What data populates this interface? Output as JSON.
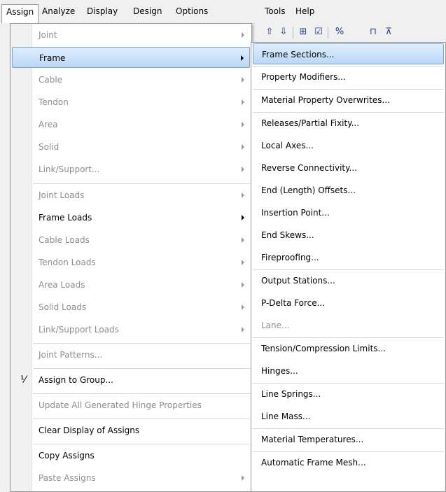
{
  "menubar": {
    "items": [
      {
        "label": "Assign"
      },
      {
        "label": "Analyze"
      },
      {
        "label": "Display"
      },
      {
        "label": "Design"
      },
      {
        "label": "Options"
      },
      {
        "label": "Tools"
      },
      {
        "label": "Help"
      }
    ]
  },
  "main_menu": {
    "items": [
      {
        "label": "Joint"
      },
      {
        "label": "Frame"
      },
      {
        "label": "Cable"
      },
      {
        "label": "Tendon"
      },
      {
        "label": "Area"
      },
      {
        "label": "Solid"
      },
      {
        "label": "Link/Support..."
      },
      {
        "label": "Joint Loads"
      },
      {
        "label": "Frame Loads"
      },
      {
        "label": "Cable Loads"
      },
      {
        "label": "Tendon Loads"
      },
      {
        "label": "Area Loads"
      },
      {
        "label": "Solid Loads"
      },
      {
        "label": "Link/Support Loads"
      },
      {
        "label": "Joint Patterns..."
      },
      {
        "label": "Assign to Group..."
      },
      {
        "label": "Update All Generated Hinge Properties"
      },
      {
        "label": "Clear Display of Assigns"
      },
      {
        "label": "Copy Assigns"
      },
      {
        "label": "Paste Assigns"
      }
    ]
  },
  "sub_menu": {
    "items": [
      {
        "label": "Frame Sections..."
      },
      {
        "label": "Property Modifiers..."
      },
      {
        "label": "Material Property Overwrites..."
      },
      {
        "label": "Releases/Partial Fixity..."
      },
      {
        "label": "Local Axes..."
      },
      {
        "label": "Reverse Connectivity..."
      },
      {
        "label": "End (Length) Offsets..."
      },
      {
        "label": "Insertion Point..."
      },
      {
        "label": "End Skews..."
      },
      {
        "label": "Fireproofing..."
      },
      {
        "label": "Output Stations..."
      },
      {
        "label": "P-Delta Force..."
      },
      {
        "label": "Lane..."
      },
      {
        "label": "Tension/Compression Limits..."
      },
      {
        "label": "Hinges..."
      },
      {
        "label": "Line Springs..."
      },
      {
        "label": "Line Mass..."
      },
      {
        "label": "Material Temperatures..."
      },
      {
        "label": "Automatic Frame Mesh..."
      }
    ]
  },
  "colors": {
    "highlight": "#bcd7f6",
    "highlight_border": "#7da2ce",
    "disabled_text": "#8d8d8d"
  }
}
